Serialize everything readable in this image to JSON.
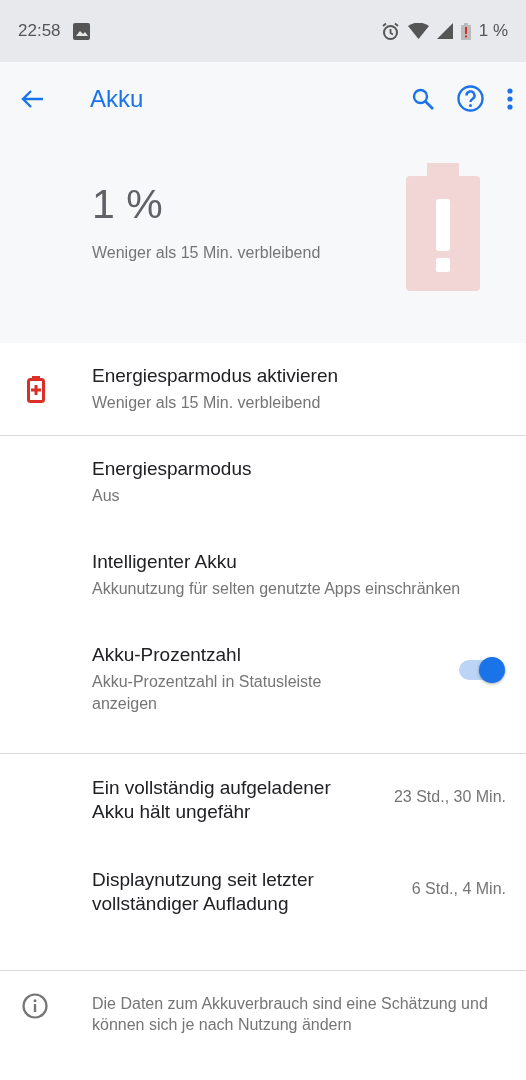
{
  "status_bar": {
    "time": "22:58",
    "battery": "1 %"
  },
  "app_bar": {
    "title": "Akku"
  },
  "summary": {
    "level_text": "1 %",
    "remaining": "Weniger als 15 Min. verbleibend"
  },
  "tip": {
    "title": "Energiesparmodus aktivieren",
    "summary": "Weniger als 15 Min. verbleibend"
  },
  "settings": [
    {
      "kind": "text",
      "title": "Energiesparmodus",
      "summary": "Aus"
    },
    {
      "kind": "text",
      "title": "Intelligenter Akku",
      "summary": "Akkunutzung für selten genutzte Apps einschränken"
    },
    {
      "kind": "switch",
      "title": "Akku-Prozentzahl",
      "summary": "Akku-Prozentzahl in Statusleiste anzeigen",
      "on": true
    }
  ],
  "usage": [
    {
      "label": "Ein vollständig aufgeladener Akku hält ungefähr",
      "value": "23 Std., 30 Min."
    },
    {
      "label": "Displaynutzung seit letzter vollständiger Aufladung",
      "value": "6 Std., 4 Min."
    }
  ],
  "footer": {
    "text": "Die Daten zum Akkuverbrauch sind eine Schätzung und können sich je nach Nutzung ändern"
  }
}
